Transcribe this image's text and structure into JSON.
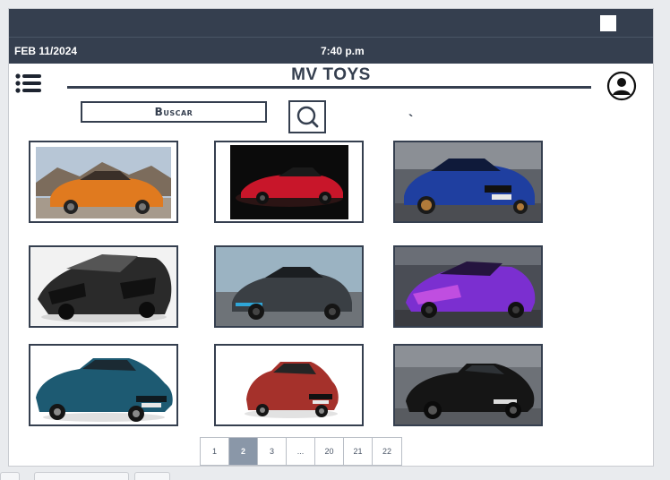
{
  "status": {
    "date": "FEB 11/2024",
    "time": "7:40 p.m"
  },
  "header": {
    "title": "MV TOYS",
    "menu_icon": "hamburger-icon",
    "avatar_icon": "user-avatar-icon"
  },
  "search": {
    "label": "Buscar",
    "button_icon": "magnifier-icon"
  },
  "mark": "`",
  "colors": {
    "bar": "#353f4f",
    "accent_page": "#8a97a8",
    "page_bg": "#ffffff"
  },
  "products": [
    {
      "id": "orange-mustang",
      "color": "#e07a1f"
    },
    {
      "id": "red-corvette",
      "color": "#c8162a"
    },
    {
      "id": "blue-bmw",
      "color": "#1f3fa0"
    },
    {
      "id": "black-lamborghini",
      "color": "#2a2a2a"
    },
    {
      "id": "black-bugatti",
      "color": "#3a3f44"
    },
    {
      "id": "purple-lamborghini",
      "color": "#7b2fd0"
    },
    {
      "id": "teal-chevrolet",
      "color": "#1d5a72"
    },
    {
      "id": "red-renault",
      "color": "#a5312b"
    },
    {
      "id": "black-porsche",
      "color": "#151515"
    }
  ],
  "pagination": {
    "pages": [
      "1",
      "2",
      "3",
      "...",
      "20",
      "21",
      "22"
    ],
    "active": "2"
  }
}
